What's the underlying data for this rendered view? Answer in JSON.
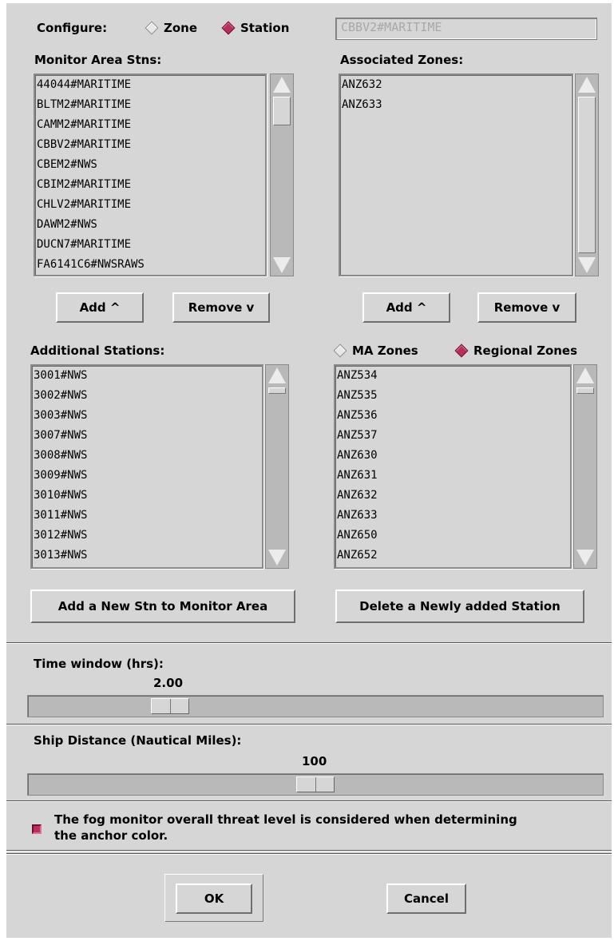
{
  "configure": {
    "label": "Configure:",
    "options": [
      {
        "label": "Zone",
        "selected": false
      },
      {
        "label": "Station",
        "selected": true
      }
    ],
    "current_value": "CBBV2#MARITIME"
  },
  "monitor_area": {
    "label": "Monitor Area Stns:",
    "items": [
      "44044#MARITIME",
      "BLTM2#MARITIME",
      "CAMM2#MARITIME",
      "CBBV2#MARITIME",
      "CBEM2#NWS",
      "CBIM2#MARITIME",
      "CHLV2#MARITIME",
      "DAWM2#NWS",
      "DUCN7#MARITIME",
      "FA6141C6#NWSRAWS"
    ]
  },
  "associated_zones": {
    "label": "Associated Zones:",
    "items": [
      "ANZ632",
      "ANZ633"
    ]
  },
  "buttons": {
    "add_left": "Add ^",
    "remove_left": "Remove v",
    "add_right": "Add ^",
    "remove_right": "Remove v",
    "add_new_stn": "Add a New Stn to Monitor Area",
    "delete_new_stn": "Delete a Newly added Station",
    "ok": "OK",
    "cancel": "Cancel"
  },
  "additional_stations": {
    "label": "Additional Stations:",
    "items": [
      "3001#NWS",
      "3002#NWS",
      "3003#NWS",
      "3007#NWS",
      "3008#NWS",
      "3009#NWS",
      "3010#NWS",
      "3011#NWS",
      "3012#NWS",
      "3013#NWS"
    ]
  },
  "zone_type": {
    "options": [
      {
        "label": "MA Zones",
        "selected": false
      },
      {
        "label": "Regional Zones",
        "selected": true
      }
    ],
    "items": [
      "ANZ534",
      "ANZ535",
      "ANZ536",
      "ANZ537",
      "ANZ630",
      "ANZ631",
      "ANZ632",
      "ANZ633",
      "ANZ650",
      "ANZ652"
    ]
  },
  "time_window": {
    "label": "Time window (hrs):",
    "value": "2.00"
  },
  "ship_distance": {
    "label": "Ship Distance (Nautical Miles):",
    "value": "100"
  },
  "threat_option": {
    "checked": true,
    "line1": "The fog monitor overall threat level  is considered when determining",
    "line2": "the anchor color."
  },
  "colors": {
    "background": "#d6d6d6",
    "selected_indicator": "#b8305a"
  }
}
